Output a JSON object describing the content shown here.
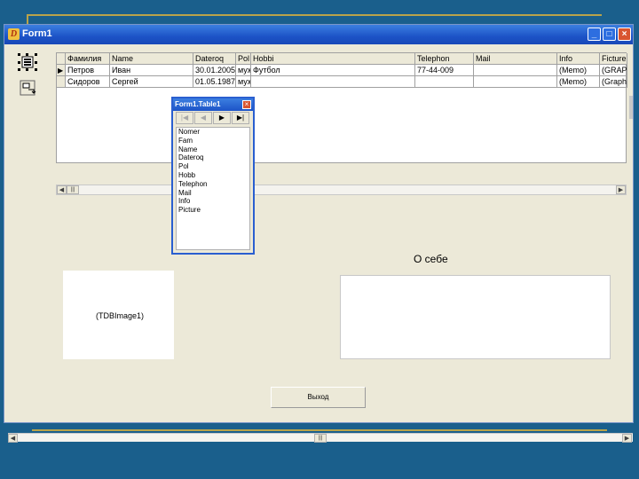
{
  "window": {
    "title": "Form1"
  },
  "grid": {
    "columns": [
      "Фамилия",
      "Name",
      "Dateroq",
      "Pol",
      "Hobbi",
      "Telephon",
      "Mail",
      "Info",
      "Ficture"
    ],
    "rows": [
      {
        "indicator": "▶",
        "cells": [
          "Петров",
          "Иван",
          "30.01.2005",
          "муж",
          "Футбол",
          "77-44-009",
          "",
          "(Memo)",
          "(GRAPH"
        ]
      },
      {
        "indicator": "",
        "cells": [
          "Сидоров",
          "Сергей",
          "01.05.1987",
          "муж",
          "",
          "",
          "",
          "(Memo)",
          "(Graphic)"
        ]
      }
    ]
  },
  "table_window": {
    "title": "Form1.Table1",
    "close_symbol": "×",
    "nav": [
      "|◀",
      "◀",
      "▶",
      "▶|"
    ],
    "fields": [
      "Nomer",
      "Fam",
      "Name",
      "Dateroq",
      "Pol",
      "Hobb",
      "Telephon",
      "Mail",
      "Info",
      "Picture"
    ]
  },
  "about_label": "О себе",
  "image_caption": "(TDBImage1)",
  "exit_button": "Выход",
  "scroll_symbols": {
    "left": "◀",
    "right": "▶",
    "grip": "|||"
  }
}
